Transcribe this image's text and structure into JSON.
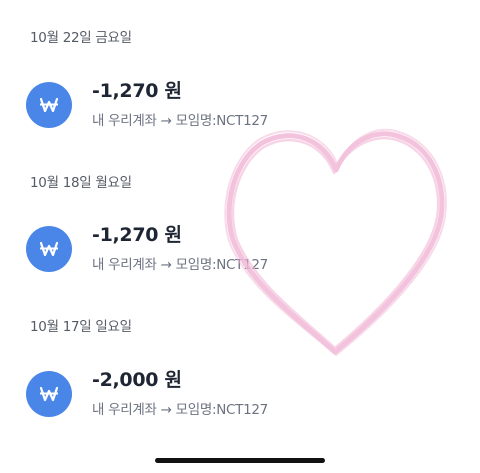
{
  "transactions": [
    {
      "date": "10월 22일 금요일",
      "amount": "-1,270 원",
      "description": "내 우리계좌 → 모임명:NCT127",
      "icon": "won-icon"
    },
    {
      "date": "10월 18일 월요일",
      "amount": "-1,270 원",
      "description": "내 우리계좌 → 모임명:NCT127",
      "icon": "won-icon"
    },
    {
      "date": "10월 17일 일요일",
      "amount": "-2,000 원",
      "description": "내 우리계좌 → 모임명:NCT127",
      "icon": "won-icon"
    }
  ],
  "colors": {
    "icon_bg": "#4a86e8",
    "heart": "#f2b8d6"
  }
}
